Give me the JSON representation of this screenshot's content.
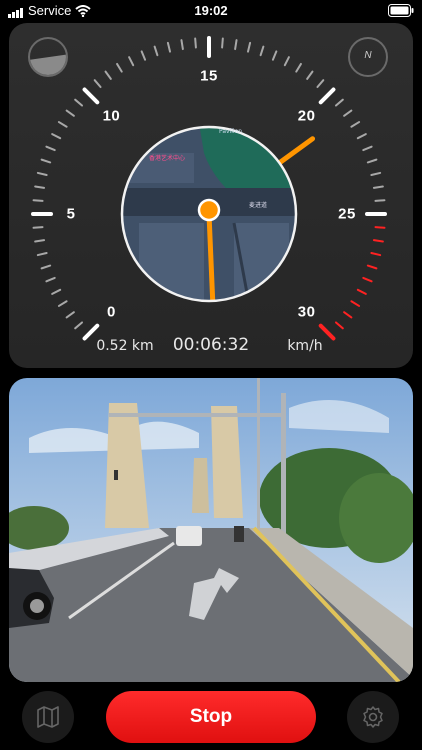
{
  "status_bar": {
    "carrier": "Service",
    "time": "19:02",
    "icons": [
      "signal-bars-icon",
      "wifi-icon",
      "battery-icon"
    ]
  },
  "speedometer": {
    "speed_scale": [
      "0",
      "5",
      "10",
      "15",
      "20",
      "25",
      "30"
    ],
    "current_speed_kmh": 21,
    "max_speed_kmh": 30,
    "distance": "0.52 km",
    "elapsed": "00:06:32",
    "unit": "km/h",
    "left_corner_icon": "level-gauge-icon",
    "right_corner_icon": "compass-icon",
    "compass_label": "N"
  },
  "map": {
    "poi_label": "香港艺术中心",
    "park_label": "Pavilion",
    "road_label": "麦进道",
    "route_color": "#ff9500",
    "park_color": "#1f6b59"
  },
  "camera": {
    "description_icon": "road-camera-view"
  },
  "controls": {
    "map_button_icon": "map-icon",
    "stop_label": "Stop",
    "settings_button_icon": "gear-icon"
  },
  "colors": {
    "accent_red": "#ff2222",
    "needle": "#ff9500",
    "panel": "#2a2a2a"
  }
}
